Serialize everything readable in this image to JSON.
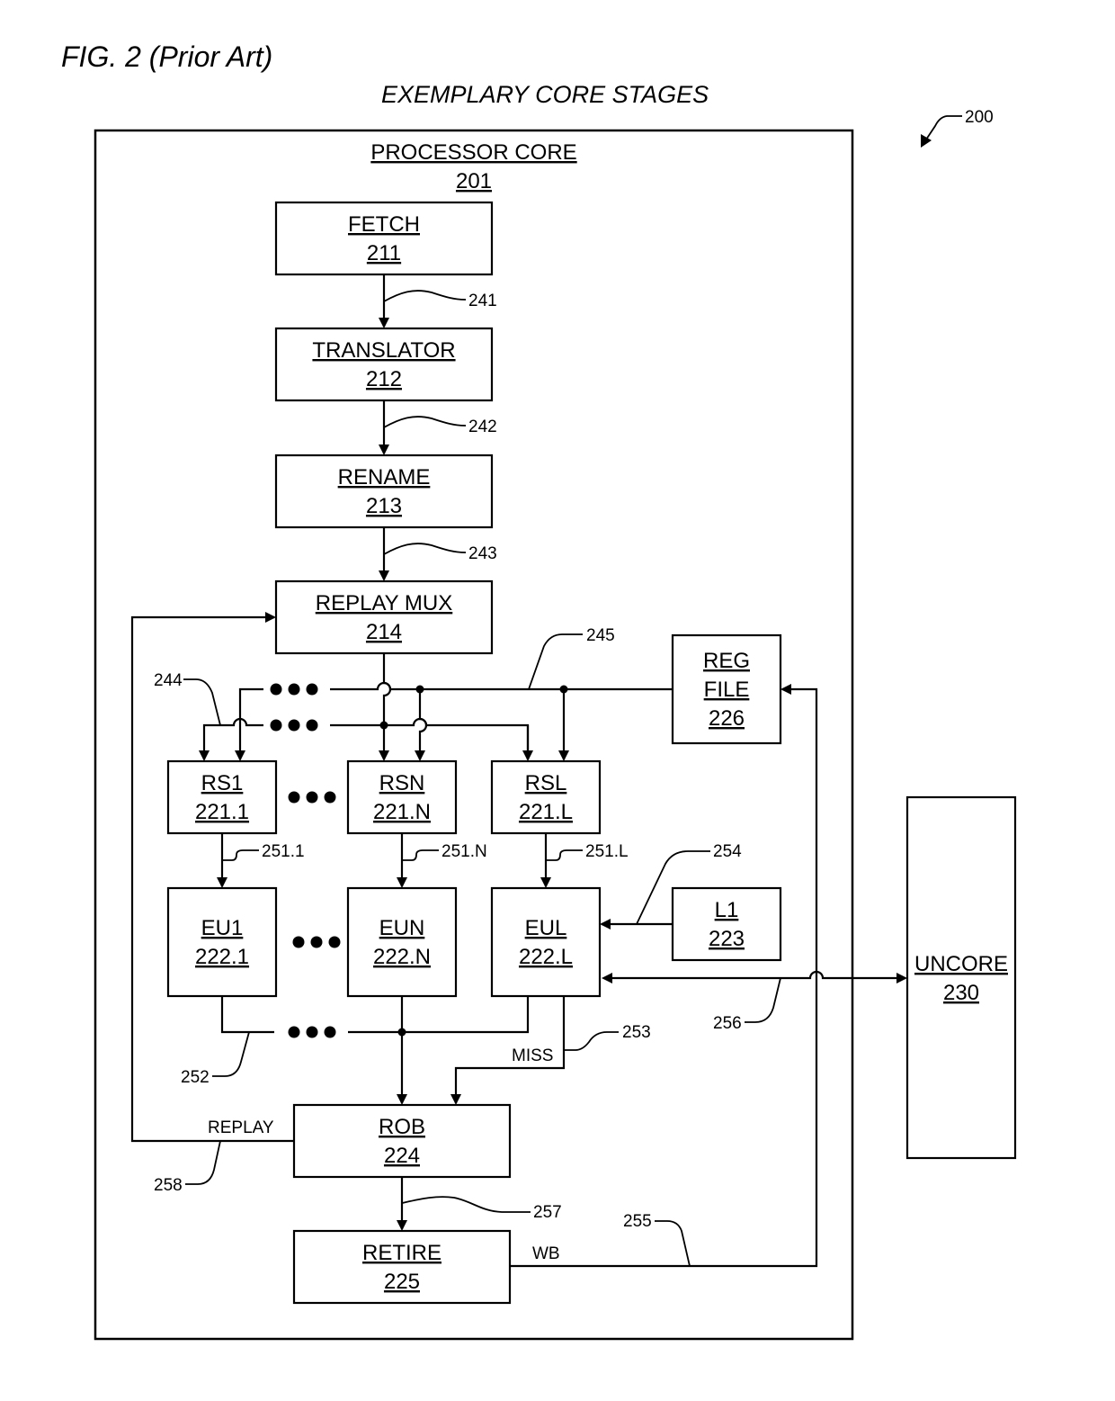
{
  "figure": {
    "title": "FIG. 2 (Prior Art)",
    "subtitle": "EXEMPLARY CORE STAGES",
    "ref": "200"
  },
  "processor_core": {
    "name": "PROCESSOR CORE",
    "ref": "201"
  },
  "blocks": {
    "fetch": {
      "name": "FETCH",
      "ref": "211"
    },
    "translator": {
      "name": "TRANSLATOR",
      "ref": "212"
    },
    "rename": {
      "name": "RENAME",
      "ref": "213"
    },
    "replay_mux": {
      "name": "REPLAY MUX",
      "ref": "214"
    },
    "rs1": {
      "name": "RS1",
      "ref": "221.1"
    },
    "rsn": {
      "name": "RSN",
      "ref": "221.N"
    },
    "rsl": {
      "name": "RSL",
      "ref": "221.L"
    },
    "eu1": {
      "name": "EU1",
      "ref": "222.1"
    },
    "eun": {
      "name": "EUN",
      "ref": "222.N"
    },
    "eul": {
      "name": "EUL",
      "ref": "222.L"
    },
    "l1": {
      "name": "L1",
      "ref": "223"
    },
    "rob": {
      "name": "ROB",
      "ref": "224"
    },
    "retire": {
      "name": "RETIRE",
      "ref": "225"
    },
    "reg_file": {
      "name_line1": "REG",
      "name_line2": "FILE",
      "ref": "226"
    },
    "uncore": {
      "name": "UNCORE",
      "ref": "230"
    }
  },
  "connections": {
    "c241": "241",
    "c242": "242",
    "c243": "243",
    "c244": "244",
    "c245": "245",
    "c251_1": "251.1",
    "c251_n": "251.N",
    "c251_l": "251.L",
    "c252": "252",
    "c253": "253",
    "c254": "254",
    "c255": "255",
    "c256": "256",
    "c257": "257",
    "c258": "258"
  },
  "signals": {
    "miss": "MISS",
    "replay": "REPLAY",
    "wb": "WB"
  }
}
